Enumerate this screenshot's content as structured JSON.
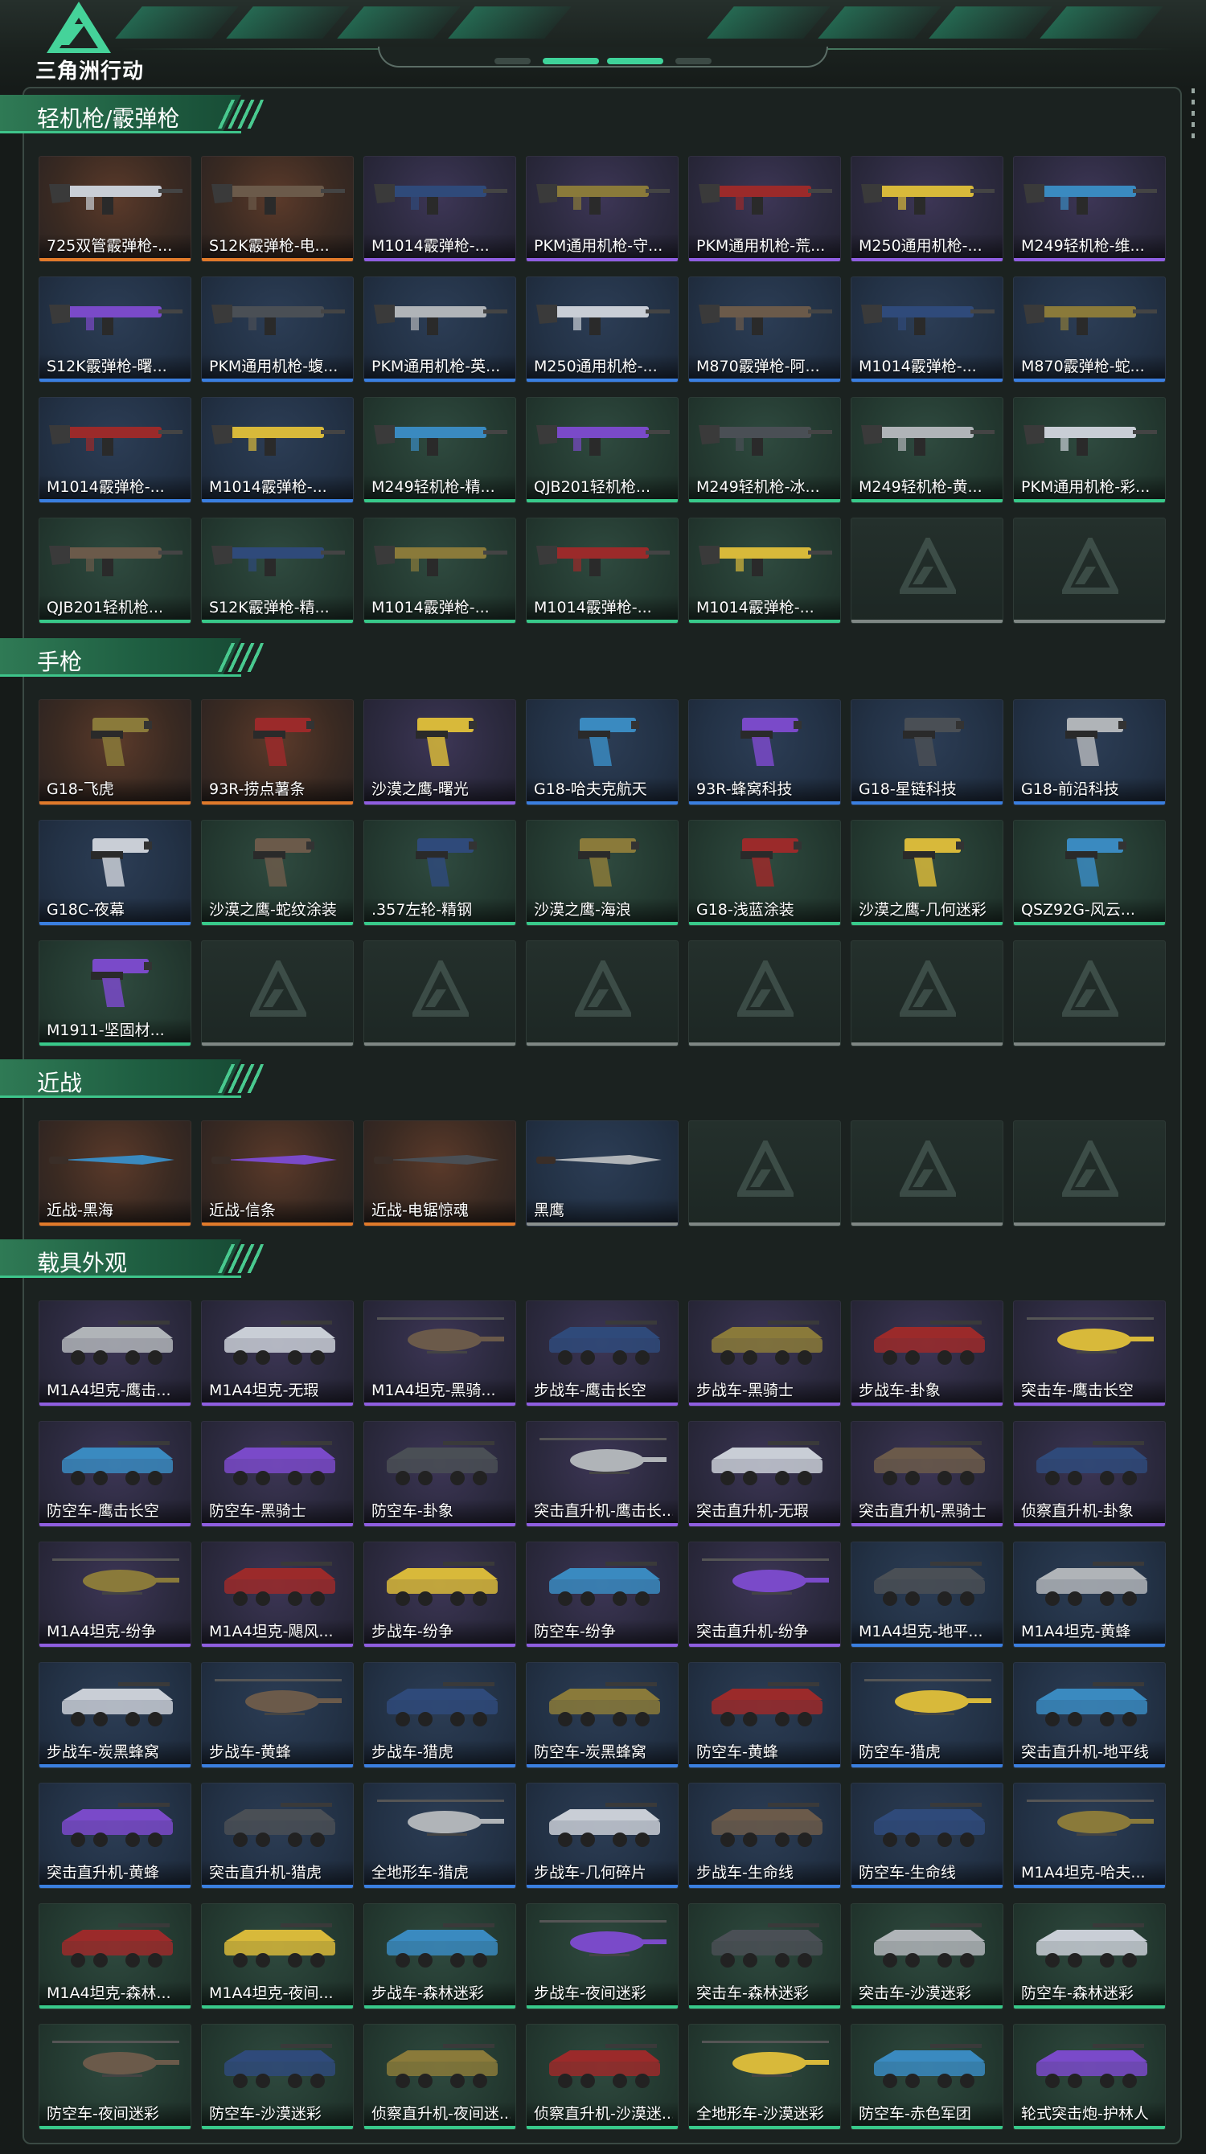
{
  "header": {
    "game_name": "三角洲行动"
  },
  "colors": {
    "orange": "#e07a2a",
    "purple": "#8f5ee0",
    "blue": "#3a7fe0",
    "green": "#38c98a",
    "accent": "#3ec48a"
  },
  "sections": [
    {
      "title": "轻机枪/霰弹枪",
      "kind": "gun",
      "items": [
        {
          "name": "725双管霰弹枪-...",
          "rarity": "orange"
        },
        {
          "name": "S12K霰弹枪-电...",
          "rarity": "orange"
        },
        {
          "name": "M1014霰弹枪-...",
          "rarity": "purple"
        },
        {
          "name": "PKM通用机枪-守...",
          "rarity": "purple"
        },
        {
          "name": "PKM通用机枪-荒...",
          "rarity": "purple"
        },
        {
          "name": "M250通用机枪-...",
          "rarity": "purple"
        },
        {
          "name": "M249轻机枪-维...",
          "rarity": "purple"
        },
        {
          "name": "S12K霰弹枪-曙...",
          "rarity": "blue"
        },
        {
          "name": "PKM通用机枪-蝮...",
          "rarity": "blue"
        },
        {
          "name": "PKM通用机枪-英...",
          "rarity": "blue"
        },
        {
          "name": "M250通用机枪-...",
          "rarity": "blue"
        },
        {
          "name": "M870霰弹枪-阿...",
          "rarity": "blue"
        },
        {
          "name": "M1014霰弹枪-...",
          "rarity": "blue"
        },
        {
          "name": "M870霰弹枪-蛇...",
          "rarity": "blue"
        },
        {
          "name": "M1014霰弹枪-...",
          "rarity": "blue"
        },
        {
          "name": "M1014霰弹枪-...",
          "rarity": "blue"
        },
        {
          "name": "M249轻机枪-精...",
          "rarity": "green"
        },
        {
          "name": "QJB201轻机枪...",
          "rarity": "green"
        },
        {
          "name": "M249轻机枪-冰...",
          "rarity": "green"
        },
        {
          "name": "M249轻机枪-黄...",
          "rarity": "green"
        },
        {
          "name": "PKM通用机枪-彩...",
          "rarity": "green"
        },
        {
          "name": "QJB201轻机枪...",
          "rarity": "green"
        },
        {
          "name": "S12K霰弹枪-精...",
          "rarity": "green"
        },
        {
          "name": "M1014霰弹枪-...",
          "rarity": "green"
        },
        {
          "name": "M1014霰弹枪-...",
          "rarity": "green"
        },
        {
          "name": "M1014霰弹枪-...",
          "rarity": "green"
        }
      ],
      "empty": 2
    },
    {
      "title": "手枪",
      "kind": "pistol",
      "items": [
        {
          "name": "G18-飞虎",
          "rarity": "orange"
        },
        {
          "name": "93R-捞点薯条",
          "rarity": "orange"
        },
        {
          "name": "沙漠之鹰-曙光",
          "rarity": "purple"
        },
        {
          "name": "G18-哈夫克航天",
          "rarity": "blue"
        },
        {
          "name": "93R-蜂窝科技",
          "rarity": "blue"
        },
        {
          "name": "G18-星链科技",
          "rarity": "blue"
        },
        {
          "name": "G18-前沿科技",
          "rarity": "blue"
        },
        {
          "name": "G18C-夜幕",
          "rarity": "blue"
        },
        {
          "name": "沙漠之鹰-蛇纹涂装",
          "rarity": "green"
        },
        {
          "name": ".357左轮-精钢",
          "rarity": "green"
        },
        {
          "name": "沙漠之鹰-海浪",
          "rarity": "green"
        },
        {
          "name": "G18-浅蓝涂装",
          "rarity": "green"
        },
        {
          "name": "沙漠之鹰-几何迷彩",
          "rarity": "green"
        },
        {
          "name": "QSZ92G-风云...",
          "rarity": "green"
        },
        {
          "name": "M1911-坚固材...",
          "rarity": "green"
        }
      ],
      "empty": 6
    },
    {
      "title": "近战",
      "kind": "melee",
      "items": [
        {
          "name": "近战-黑海",
          "rarity": "orange"
        },
        {
          "name": "近战-信条",
          "rarity": "orange"
        },
        {
          "name": "近战-电锯惊魂",
          "rarity": "orange"
        },
        {
          "name": "黑鹰",
          "rarity": "gray"
        }
      ],
      "empty": 3
    },
    {
      "title": "载具外观",
      "kind": "vehicle",
      "items": [
        {
          "name": "M1A4坦克-鹰击...",
          "rarity": "purple"
        },
        {
          "name": "M1A4坦克-无瑕",
          "rarity": "purple"
        },
        {
          "name": "M1A4坦克-黑骑...",
          "rarity": "purple"
        },
        {
          "name": "步战车-鹰击长空",
          "rarity": "purple"
        },
        {
          "name": "步战车-黑骑士",
          "rarity": "purple"
        },
        {
          "name": "步战车-卦象",
          "rarity": "purple"
        },
        {
          "name": "突击车-鹰击长空",
          "rarity": "purple"
        },
        {
          "name": "防空车-鹰击长空",
          "rarity": "purple"
        },
        {
          "name": "防空车-黑骑士",
          "rarity": "purple"
        },
        {
          "name": "防空车-卦象",
          "rarity": "purple"
        },
        {
          "name": "突击直升机-鹰击长...",
          "rarity": "purple"
        },
        {
          "name": "突击直升机-无瑕",
          "rarity": "purple"
        },
        {
          "name": "突击直升机-黑骑士",
          "rarity": "purple"
        },
        {
          "name": "侦察直升机-卦象",
          "rarity": "purple"
        },
        {
          "name": "M1A4坦克-纷争",
          "rarity": "purple"
        },
        {
          "name": "M1A4坦克-飓风...",
          "rarity": "purple"
        },
        {
          "name": "步战车-纷争",
          "rarity": "purple"
        },
        {
          "name": "防空车-纷争",
          "rarity": "purple"
        },
        {
          "name": "突击直升机-纷争",
          "rarity": "purple"
        },
        {
          "name": "M1A4坦克-地平...",
          "rarity": "blue"
        },
        {
          "name": "M1A4坦克-黄蜂",
          "rarity": "blue"
        },
        {
          "name": "步战车-炭黑蜂窝",
          "rarity": "blue"
        },
        {
          "name": "步战车-黄蜂",
          "rarity": "blue"
        },
        {
          "name": "步战车-猎虎",
          "rarity": "blue"
        },
        {
          "name": "防空车-炭黑蜂窝",
          "rarity": "blue"
        },
        {
          "name": "防空车-黄蜂",
          "rarity": "blue"
        },
        {
          "name": "防空车-猎虎",
          "rarity": "blue"
        },
        {
          "name": "突击直升机-地平线",
          "rarity": "blue"
        },
        {
          "name": "突击直升机-黄蜂",
          "rarity": "blue"
        },
        {
          "name": "突击直升机-猎虎",
          "rarity": "blue"
        },
        {
          "name": "全地形车-猎虎",
          "rarity": "blue"
        },
        {
          "name": "步战车-几何碎片",
          "rarity": "blue"
        },
        {
          "name": "步战车-生命线",
          "rarity": "blue"
        },
        {
          "name": "防空车-生命线",
          "rarity": "blue"
        },
        {
          "name": "M1A4坦克-哈夫...",
          "rarity": "blue"
        },
        {
          "name": "M1A4坦克-森林...",
          "rarity": "green"
        },
        {
          "name": "M1A4坦克-夜间...",
          "rarity": "green"
        },
        {
          "name": "步战车-森林迷彩",
          "rarity": "green"
        },
        {
          "name": "步战车-夜间迷彩",
          "rarity": "green"
        },
        {
          "name": "突击车-森林迷彩",
          "rarity": "green"
        },
        {
          "name": "突击车-沙漠迷彩",
          "rarity": "green"
        },
        {
          "name": "防空车-森林迷彩",
          "rarity": "green"
        },
        {
          "name": "防空车-夜间迷彩",
          "rarity": "green"
        },
        {
          "name": "防空车-沙漠迷彩",
          "rarity": "green"
        },
        {
          "name": "侦察直升机-夜间迷...",
          "rarity": "green"
        },
        {
          "name": "侦察直升机-沙漠迷...",
          "rarity": "green"
        },
        {
          "name": "全地形车-沙漠迷彩",
          "rarity": "green"
        },
        {
          "name": "防空车-赤色军团",
          "rarity": "green"
        },
        {
          "name": "轮式突击炮-护林人",
          "rarity": "green"
        }
      ],
      "empty": 0
    }
  ]
}
